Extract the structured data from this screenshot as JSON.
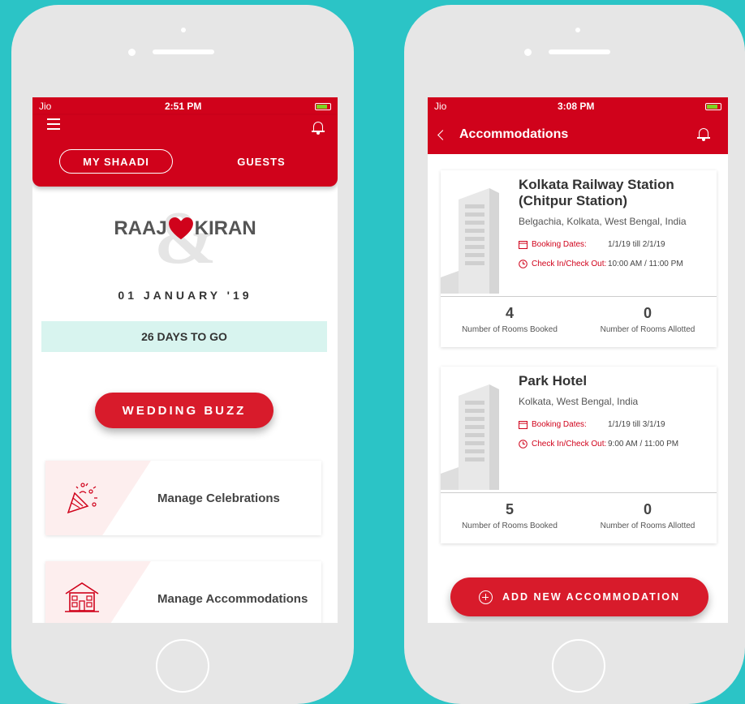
{
  "colors": {
    "background": "#2bc4c6",
    "primary": "#d0021b",
    "countdown_bg": "#d8f4ef"
  },
  "left_screen": {
    "status": {
      "carrier": "Jio",
      "time": "2:51 PM"
    },
    "header": {
      "menu_icon": "hamburger-icon",
      "bell_icon": "bell-icon",
      "tabs": [
        "MY SHAADI",
        "GUESTS"
      ],
      "active_tab": "MY SHAADI"
    },
    "couple": {
      "name1": "RAAJ",
      "name2": "KIRAN",
      "amp": "&"
    },
    "date": "01 JANUARY '19",
    "countdown": "26 DAYS TO GO",
    "buzz_button": "WEDDING BUZZ",
    "cards": [
      {
        "label": "Manage Celebrations",
        "icon": "party-popper-icon"
      },
      {
        "label": "Manage Accommodations",
        "icon": "house-icon"
      }
    ]
  },
  "right_screen": {
    "status": {
      "carrier": "Jio",
      "time": "3:08 PM"
    },
    "header": {
      "title": "Accommodations",
      "back_icon": "back-chevron-icon",
      "bell_icon": "bell-icon"
    },
    "accommodations": [
      {
        "name": "Kolkata Railway Station (Chitpur Station)",
        "location": "Belgachia, Kolkata, West Bengal, India",
        "booking_label": "Booking Dates:",
        "booking_dates": "1/1/19 till 2/1/19",
        "checkin_label": "Check In/Check Out:",
        "checkin_times": "10:00 AM / 11:00 PM",
        "rooms_booked": "4",
        "rooms_booked_label": "Number of Rooms Booked",
        "rooms_allotted": "0",
        "rooms_allotted_label": "Number of Rooms Allotted"
      },
      {
        "name": "Park Hotel",
        "location": "Kolkata, West Bengal, India",
        "booking_label": "Booking Dates:",
        "booking_dates": "1/1/19 till 3/1/19",
        "checkin_label": "Check In/Check Out:",
        "checkin_times": "9:00 AM / 11:00 PM",
        "rooms_booked": "5",
        "rooms_booked_label": "Number of Rooms Booked",
        "rooms_allotted": "0",
        "rooms_allotted_label": "Number of Rooms Allotted"
      }
    ],
    "add_button": "ADD NEW ACCOMMODATION"
  }
}
